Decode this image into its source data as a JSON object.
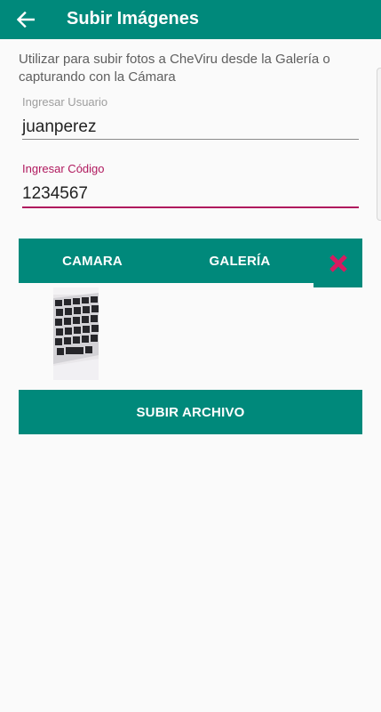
{
  "appbar": {
    "back_icon": "arrow-left-icon",
    "title": "Subir Imágenes"
  },
  "description": "Utilizar para subir fotos a CheViru desde la Galería o capturando con la Cámara",
  "user_field": {
    "label": "Ingresar Usuario",
    "value": "juanperez"
  },
  "code_field": {
    "label": "Ingresar Código",
    "value": "1234567",
    "accent_color": "#b0195e"
  },
  "buttons": {
    "camera": "CAMARA",
    "gallery": "GALERÍA",
    "clear_icon": "close-x-icon",
    "clear_icon_color": "#d81b60",
    "upload": "SUBIR ARCHIVO"
  },
  "thumbnail": {
    "subject": "keyboard-photo"
  },
  "colors": {
    "primary": "#00897b",
    "background": "#fafafa"
  }
}
